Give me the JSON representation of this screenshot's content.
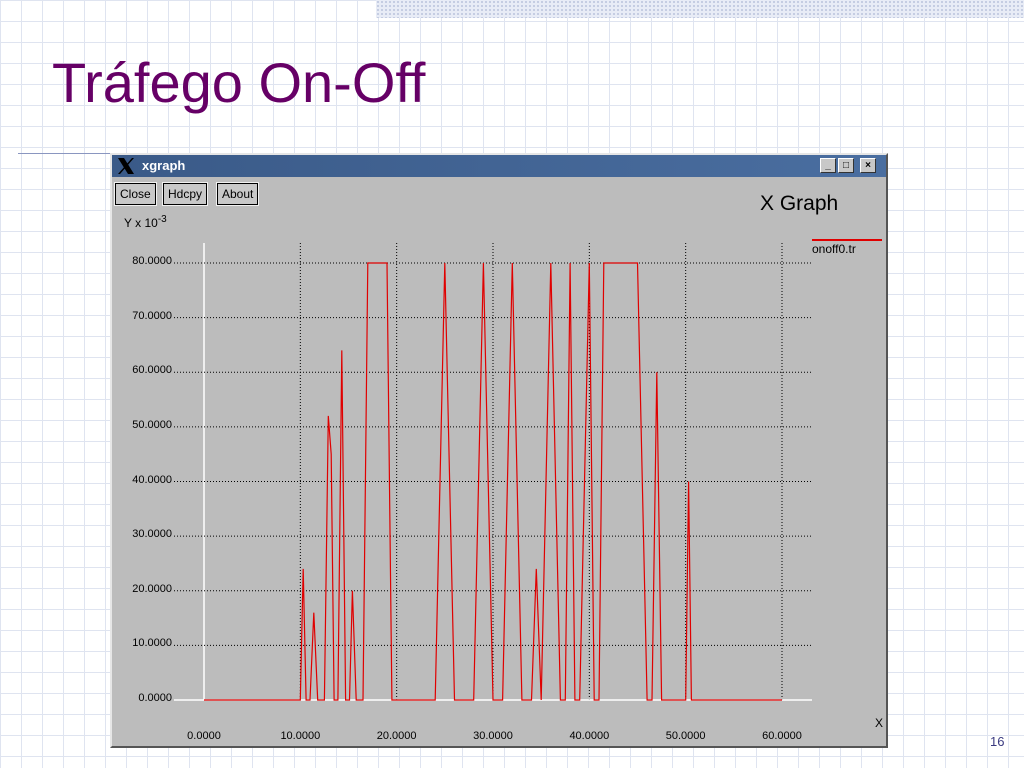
{
  "slide": {
    "title": "Tráfego On-Off",
    "page_number": "16"
  },
  "window": {
    "title": "xgraph",
    "controls": {
      "minimize": "_",
      "maximize": "□",
      "close": "×"
    },
    "toolbar": {
      "close_label": "Close",
      "hdcpy_label": "Hdcpy",
      "about_label": "About"
    }
  },
  "chart_data": {
    "type": "line",
    "title": "X Graph",
    "ylabel": "Y x 10",
    "ylabel_exponent": "-3",
    "xlabel": "X",
    "xlim": [
      0,
      60
    ],
    "ylim": [
      0,
      80
    ],
    "grid": true,
    "legend_position": "top-right",
    "xticks": [
      "0.0000",
      "10.0000",
      "20.0000",
      "30.0000",
      "40.0000",
      "50.0000",
      "60.0000"
    ],
    "yticks": [
      "0.0000",
      "10.0000",
      "20.0000",
      "30.0000",
      "40.0000",
      "50.0000",
      "60.0000",
      "70.0000",
      "80.0000"
    ],
    "series": [
      {
        "name": "onoff0.tr",
        "color": "#e00000",
        "x": [
          0,
          10,
          10.3,
          10.6,
          11.0,
          11.4,
          11.8,
          12.2,
          12.5,
          12.9,
          13.2,
          13.5,
          13.9,
          14.3,
          14.7,
          15.1,
          15.4,
          15.8,
          16.1,
          16.5,
          17.0,
          17.5,
          18.0,
          18.5,
          19.0,
          19.5,
          20.0,
          24.0,
          25.0,
          26.0,
          28.0,
          29.0,
          30.0,
          31.0,
          32.0,
          33.0,
          34.0,
          34.5,
          35.0,
          36.0,
          37.0,
          37.5,
          38.0,
          38.5,
          39.0,
          40.0,
          40.5,
          41.0,
          41.5,
          42.0,
          43.0,
          44.0,
          45.0,
          46.0,
          46.5,
          47.0,
          47.5,
          48.0,
          48.5,
          49.5,
          50.0,
          50.3,
          50.6,
          51.0,
          60.0
        ],
        "y": [
          0,
          0,
          24,
          0,
          0,
          16,
          0,
          0,
          0,
          52,
          45,
          0,
          0,
          64,
          0,
          0,
          20,
          0,
          0,
          0,
          80,
          80,
          80,
          80,
          80,
          0,
          0,
          0,
          80,
          0,
          0,
          80,
          0,
          0,
          80,
          0,
          0,
          24,
          0,
          80,
          0,
          0,
          80,
          0,
          0,
          80,
          0,
          0,
          80,
          80,
          80,
          80,
          80,
          0,
          0,
          60,
          0,
          0,
          0,
          0,
          0,
          40,
          0,
          0,
          0
        ]
      }
    ]
  }
}
